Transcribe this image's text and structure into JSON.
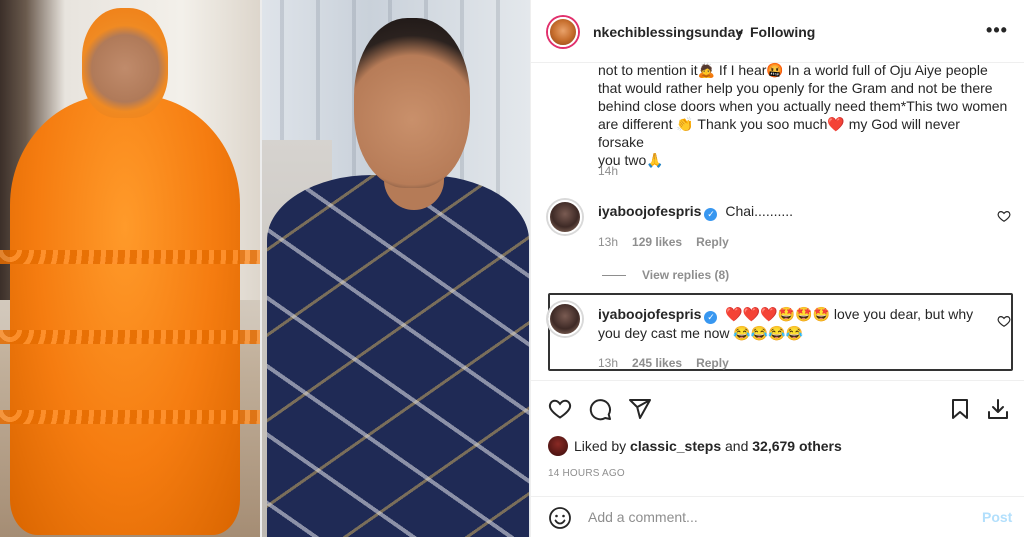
{
  "post": {
    "username": "nkechiblessingsunday",
    "separator": "•",
    "following_label": "Following",
    "more_label": "•••"
  },
  "caption": {
    "line1": "not to mention it🙇 If I hear🤬 In a world full of Oju Aiye people",
    "line2": "that would rather help you openly for the Gram and not be there",
    "line3": "behind close doors when you actually need them*This two women",
    "line4": "are different 👏 Thank you soo much❤️ my God will never forsake",
    "line5": "you two🙏",
    "time": "14h"
  },
  "comments": [
    {
      "username": "iyaboojofespris",
      "verified": "✓",
      "text": "Chai..........",
      "time": "13h",
      "likes": "129 likes",
      "reply": "Reply"
    },
    {
      "username": "iyaboojofespris",
      "verified": "✓",
      "text_line1": "❤️❤️❤️🤩🤩🤩 love you dear, but why",
      "text_line2": "you dey cast me now 😂😂😂😂",
      "time": "13h",
      "likes": "245 likes",
      "reply": "Reply"
    }
  ],
  "view_replies": "View replies (8)",
  "likes": {
    "prefix": "Liked by",
    "user": "classic_steps",
    "middle": "and",
    "count": "32,679 others"
  },
  "posted_ago": "14 HOURS AGO",
  "add_comment": {
    "placeholder": "Add a comment...",
    "post_label": "Post"
  },
  "colors": {
    "accent": "#3897f0",
    "post_disabled": "#b2dffc",
    "muted": "#8e8e8e"
  },
  "icons": [
    "heart-icon",
    "comment-icon",
    "share-icon",
    "save-icon",
    "download-icon",
    "emoji-icon",
    "more-icon",
    "verified-icon"
  ]
}
